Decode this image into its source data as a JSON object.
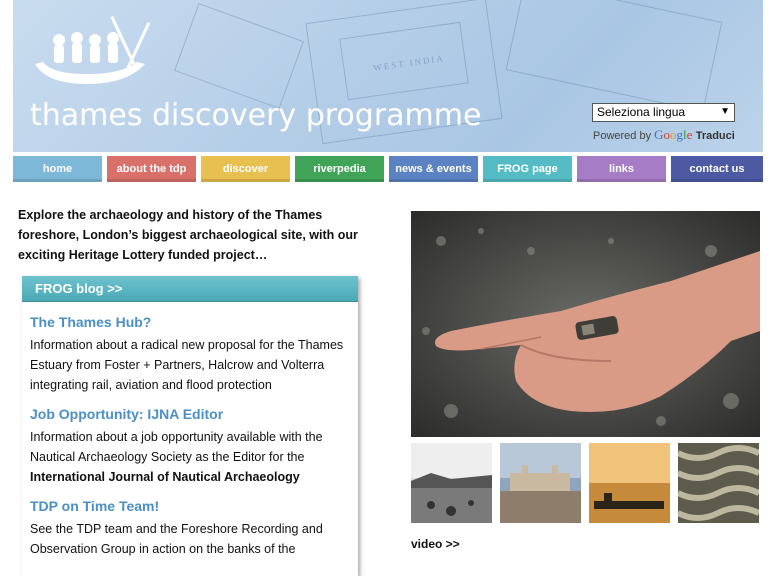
{
  "header": {
    "title": "thames discovery programme",
    "language_select": "Seleziona lingua",
    "powered_by": "Powered by",
    "google": "Google",
    "translate": "Traduci"
  },
  "nav": {
    "items": [
      {
        "label": "home",
        "color": "#7db8d8"
      },
      {
        "label": "about the tdp",
        "color": "#d9706a"
      },
      {
        "label": "discover",
        "color": "#e8c04f"
      },
      {
        "label": "riverpedia",
        "color": "#3fa358"
      },
      {
        "label": "news & events",
        "color": "#5b82c2"
      },
      {
        "label": "FROG page",
        "color": "#55bcc6"
      },
      {
        "label": "links",
        "color": "#a67cc6"
      },
      {
        "label": "contact us",
        "color": "#4d5aa3"
      }
    ]
  },
  "intro": "Explore the archaeology and history of the Thames foreshore, London’s biggest archaeological site, with our exciting Heritage Lottery funded project…",
  "blog": {
    "header": "FROG blog >>",
    "posts": [
      {
        "title": "The Thames Hub?",
        "body": "Information about a radical new proposal for the Thames Estuary from Foster + Partners, Halcrow and Volterra integrating rail, aviation and flood protection"
      },
      {
        "title": "Job Opportunity: IJNA Editor",
        "body": "Information about a job opportunity available with the Nautical Archaeology Society as the Editor for the",
        "body_bold": "International Journal of Nautical Archaeology"
      },
      {
        "title": "TDP on Time Team!",
        "body": "See the TDP team and the Foreshore Recording and Observation Group in action on the banks of the"
      }
    ]
  },
  "video_link": "video >>"
}
